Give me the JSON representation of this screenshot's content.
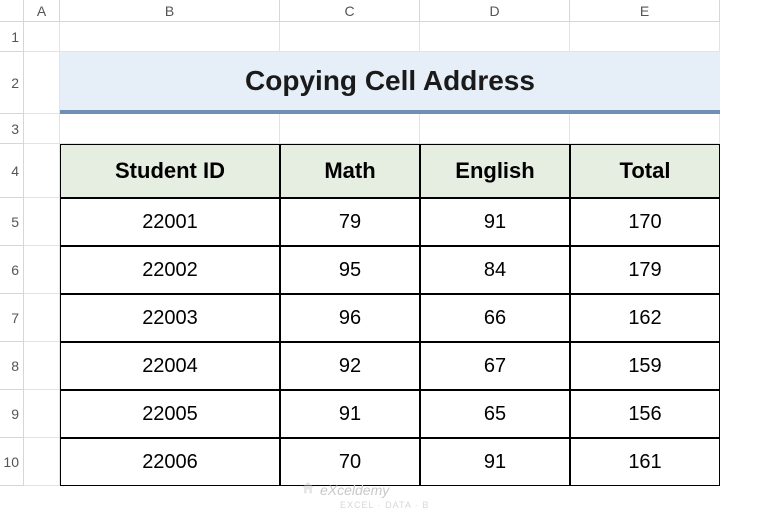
{
  "columns": [
    "A",
    "B",
    "C",
    "D",
    "E"
  ],
  "rows": [
    "1",
    "2",
    "3",
    "4",
    "5",
    "6",
    "7",
    "8",
    "9",
    "10"
  ],
  "title": "Copying Cell Address",
  "table": {
    "headers": [
      "Student ID",
      "Math",
      "English",
      "Total"
    ],
    "data": [
      [
        "22001",
        "79",
        "91",
        "170"
      ],
      [
        "22002",
        "95",
        "84",
        "179"
      ],
      [
        "22003",
        "96",
        "66",
        "162"
      ],
      [
        "22004",
        "92",
        "67",
        "159"
      ],
      [
        "22005",
        "91",
        "65",
        "156"
      ],
      [
        "22006",
        "70",
        "91",
        "161"
      ]
    ]
  },
  "watermark": {
    "brand": "eXceldemy",
    "sub": "EXCEL · DATA · B"
  },
  "chart_data": {
    "type": "table",
    "title": "Copying Cell Address",
    "columns": [
      "Student ID",
      "Math",
      "English",
      "Total"
    ],
    "rows": [
      {
        "Student ID": 22001,
        "Math": 79,
        "English": 91,
        "Total": 170
      },
      {
        "Student ID": 22002,
        "Math": 95,
        "English": 84,
        "Total": 179
      },
      {
        "Student ID": 22003,
        "Math": 96,
        "English": 66,
        "Total": 162
      },
      {
        "Student ID": 22004,
        "Math": 92,
        "English": 67,
        "Total": 159
      },
      {
        "Student ID": 22005,
        "Math": 91,
        "English": 65,
        "Total": 156
      },
      {
        "Student ID": 22006,
        "Math": 70,
        "English": 91,
        "Total": 161
      }
    ]
  }
}
